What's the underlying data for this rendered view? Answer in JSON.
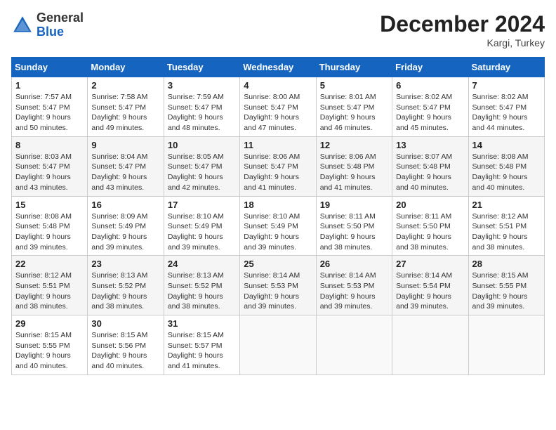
{
  "logo": {
    "general": "General",
    "blue": "Blue"
  },
  "title": "December 2024",
  "location": "Kargi, Turkey",
  "days_header": [
    "Sunday",
    "Monday",
    "Tuesday",
    "Wednesday",
    "Thursday",
    "Friday",
    "Saturday"
  ],
  "weeks": [
    [
      {
        "day": "1",
        "sunrise": "Sunrise: 7:57 AM",
        "sunset": "Sunset: 5:47 PM",
        "daylight": "Daylight: 9 hours and 50 minutes."
      },
      {
        "day": "2",
        "sunrise": "Sunrise: 7:58 AM",
        "sunset": "Sunset: 5:47 PM",
        "daylight": "Daylight: 9 hours and 49 minutes."
      },
      {
        "day": "3",
        "sunrise": "Sunrise: 7:59 AM",
        "sunset": "Sunset: 5:47 PM",
        "daylight": "Daylight: 9 hours and 48 minutes."
      },
      {
        "day": "4",
        "sunrise": "Sunrise: 8:00 AM",
        "sunset": "Sunset: 5:47 PM",
        "daylight": "Daylight: 9 hours and 47 minutes."
      },
      {
        "day": "5",
        "sunrise": "Sunrise: 8:01 AM",
        "sunset": "Sunset: 5:47 PM",
        "daylight": "Daylight: 9 hours and 46 minutes."
      },
      {
        "day": "6",
        "sunrise": "Sunrise: 8:02 AM",
        "sunset": "Sunset: 5:47 PM",
        "daylight": "Daylight: 9 hours and 45 minutes."
      },
      {
        "day": "7",
        "sunrise": "Sunrise: 8:02 AM",
        "sunset": "Sunset: 5:47 PM",
        "daylight": "Daylight: 9 hours and 44 minutes."
      }
    ],
    [
      {
        "day": "8",
        "sunrise": "Sunrise: 8:03 AM",
        "sunset": "Sunset: 5:47 PM",
        "daylight": "Daylight: 9 hours and 43 minutes."
      },
      {
        "day": "9",
        "sunrise": "Sunrise: 8:04 AM",
        "sunset": "Sunset: 5:47 PM",
        "daylight": "Daylight: 9 hours and 43 minutes."
      },
      {
        "day": "10",
        "sunrise": "Sunrise: 8:05 AM",
        "sunset": "Sunset: 5:47 PM",
        "daylight": "Daylight: 9 hours and 42 minutes."
      },
      {
        "day": "11",
        "sunrise": "Sunrise: 8:06 AM",
        "sunset": "Sunset: 5:47 PM",
        "daylight": "Daylight: 9 hours and 41 minutes."
      },
      {
        "day": "12",
        "sunrise": "Sunrise: 8:06 AM",
        "sunset": "Sunset: 5:48 PM",
        "daylight": "Daylight: 9 hours and 41 minutes."
      },
      {
        "day": "13",
        "sunrise": "Sunrise: 8:07 AM",
        "sunset": "Sunset: 5:48 PM",
        "daylight": "Daylight: 9 hours and 40 minutes."
      },
      {
        "day": "14",
        "sunrise": "Sunrise: 8:08 AM",
        "sunset": "Sunset: 5:48 PM",
        "daylight": "Daylight: 9 hours and 40 minutes."
      }
    ],
    [
      {
        "day": "15",
        "sunrise": "Sunrise: 8:08 AM",
        "sunset": "Sunset: 5:48 PM",
        "daylight": "Daylight: 9 hours and 39 minutes."
      },
      {
        "day": "16",
        "sunrise": "Sunrise: 8:09 AM",
        "sunset": "Sunset: 5:49 PM",
        "daylight": "Daylight: 9 hours and 39 minutes."
      },
      {
        "day": "17",
        "sunrise": "Sunrise: 8:10 AM",
        "sunset": "Sunset: 5:49 PM",
        "daylight": "Daylight: 9 hours and 39 minutes."
      },
      {
        "day": "18",
        "sunrise": "Sunrise: 8:10 AM",
        "sunset": "Sunset: 5:49 PM",
        "daylight": "Daylight: 9 hours and 39 minutes."
      },
      {
        "day": "19",
        "sunrise": "Sunrise: 8:11 AM",
        "sunset": "Sunset: 5:50 PM",
        "daylight": "Daylight: 9 hours and 38 minutes."
      },
      {
        "day": "20",
        "sunrise": "Sunrise: 8:11 AM",
        "sunset": "Sunset: 5:50 PM",
        "daylight": "Daylight: 9 hours and 38 minutes."
      },
      {
        "day": "21",
        "sunrise": "Sunrise: 8:12 AM",
        "sunset": "Sunset: 5:51 PM",
        "daylight": "Daylight: 9 hours and 38 minutes."
      }
    ],
    [
      {
        "day": "22",
        "sunrise": "Sunrise: 8:12 AM",
        "sunset": "Sunset: 5:51 PM",
        "daylight": "Daylight: 9 hours and 38 minutes."
      },
      {
        "day": "23",
        "sunrise": "Sunrise: 8:13 AM",
        "sunset": "Sunset: 5:52 PM",
        "daylight": "Daylight: 9 hours and 38 minutes."
      },
      {
        "day": "24",
        "sunrise": "Sunrise: 8:13 AM",
        "sunset": "Sunset: 5:52 PM",
        "daylight": "Daylight: 9 hours and 38 minutes."
      },
      {
        "day": "25",
        "sunrise": "Sunrise: 8:14 AM",
        "sunset": "Sunset: 5:53 PM",
        "daylight": "Daylight: 9 hours and 39 minutes."
      },
      {
        "day": "26",
        "sunrise": "Sunrise: 8:14 AM",
        "sunset": "Sunset: 5:53 PM",
        "daylight": "Daylight: 9 hours and 39 minutes."
      },
      {
        "day": "27",
        "sunrise": "Sunrise: 8:14 AM",
        "sunset": "Sunset: 5:54 PM",
        "daylight": "Daylight: 9 hours and 39 minutes."
      },
      {
        "day": "28",
        "sunrise": "Sunrise: 8:15 AM",
        "sunset": "Sunset: 5:55 PM",
        "daylight": "Daylight: 9 hours and 39 minutes."
      }
    ],
    [
      {
        "day": "29",
        "sunrise": "Sunrise: 8:15 AM",
        "sunset": "Sunset: 5:55 PM",
        "daylight": "Daylight: 9 hours and 40 minutes."
      },
      {
        "day": "30",
        "sunrise": "Sunrise: 8:15 AM",
        "sunset": "Sunset: 5:56 PM",
        "daylight": "Daylight: 9 hours and 40 minutes."
      },
      {
        "day": "31",
        "sunrise": "Sunrise: 8:15 AM",
        "sunset": "Sunset: 5:57 PM",
        "daylight": "Daylight: 9 hours and 41 minutes."
      },
      null,
      null,
      null,
      null
    ]
  ]
}
